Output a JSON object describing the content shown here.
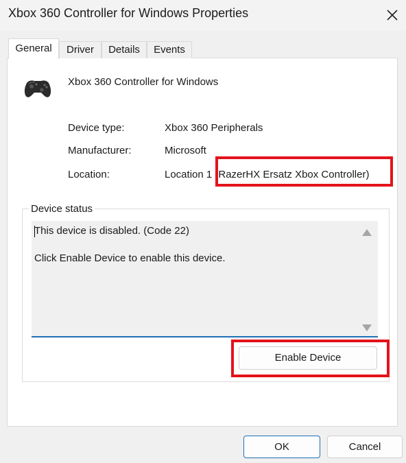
{
  "window": {
    "title": "Xbox 360 Controller for Windows Properties"
  },
  "tabs": [
    {
      "label": "General",
      "active": true
    },
    {
      "label": "Driver",
      "active": false
    },
    {
      "label": "Details",
      "active": false
    },
    {
      "label": "Events",
      "active": false
    }
  ],
  "device": {
    "name": "Xbox 360 Controller for Windows",
    "icon": "gamepad-icon",
    "properties": [
      {
        "label": "Device type:",
        "value": "Xbox 360 Peripherals"
      },
      {
        "label": "Manufacturer:",
        "value": "Microsoft"
      },
      {
        "label": "Location:",
        "value": "Location 1 (RazerHX Ersatz Xbox Controller)"
      }
    ]
  },
  "status": {
    "group_label": "Device status",
    "lines": [
      "This device is disabled. (Code 22)",
      "Click Enable Device to enable this device."
    ]
  },
  "buttons": {
    "enable": "Enable Device",
    "ok": "OK",
    "cancel": "Cancel"
  },
  "colors": {
    "highlight": "#e3121b",
    "accent": "#1f6fb5"
  }
}
